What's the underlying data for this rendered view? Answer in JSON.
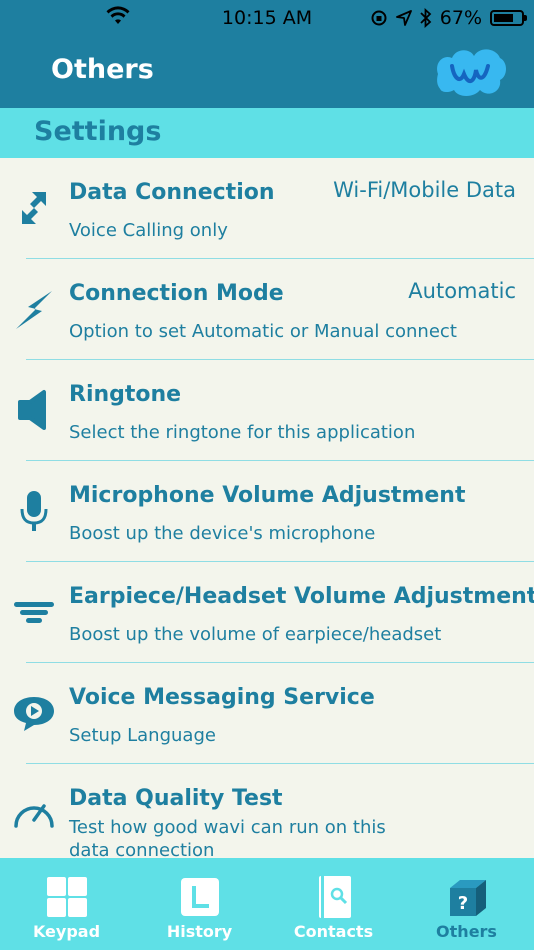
{
  "status_bar": {
    "time": "10:15 AM",
    "battery": "67%"
  },
  "nav": {
    "title": "Others"
  },
  "section": {
    "label": "Settings"
  },
  "settings": [
    {
      "title": "Data Connection",
      "subtitle": "Voice Calling only",
      "value": "Wi-Fi/Mobile Data",
      "icon": "arrows-icon"
    },
    {
      "title": "Connection Mode",
      "subtitle": "Option to set Automatic or Manual connect",
      "value": "Automatic",
      "icon": "lightning-icon"
    },
    {
      "title": "Ringtone",
      "subtitle": "Select the ringtone for this application",
      "value": "",
      "icon": "speaker-icon"
    },
    {
      "title": "Microphone Volume Adjustment",
      "subtitle": "Boost up the device's microphone",
      "value": "",
      "icon": "microphone-icon"
    },
    {
      "title": "Earpiece/Headset Volume Adjustment",
      "subtitle": "Boost up the volume of earpiece/headset",
      "value": "",
      "icon": "volume-bars-icon"
    },
    {
      "title": "Voice Messaging Service",
      "subtitle": "Setup Language",
      "value": "",
      "icon": "voice-message-icon"
    },
    {
      "title": "Data Quality Test",
      "subtitle": "Test how good wavi can run on this data connection",
      "value": "",
      "icon": "speedometer-icon"
    }
  ],
  "tabs": [
    {
      "label": "Keypad",
      "icon": "keypad-icon"
    },
    {
      "label": "History",
      "icon": "history-icon"
    },
    {
      "label": "Contacts",
      "icon": "contacts-icon"
    },
    {
      "label": "Others",
      "icon": "others-icon",
      "active": true
    }
  ],
  "colors": {
    "primary": "#1e7fa0",
    "accent": "#5fe0e6",
    "background": "#f3f5ec"
  }
}
